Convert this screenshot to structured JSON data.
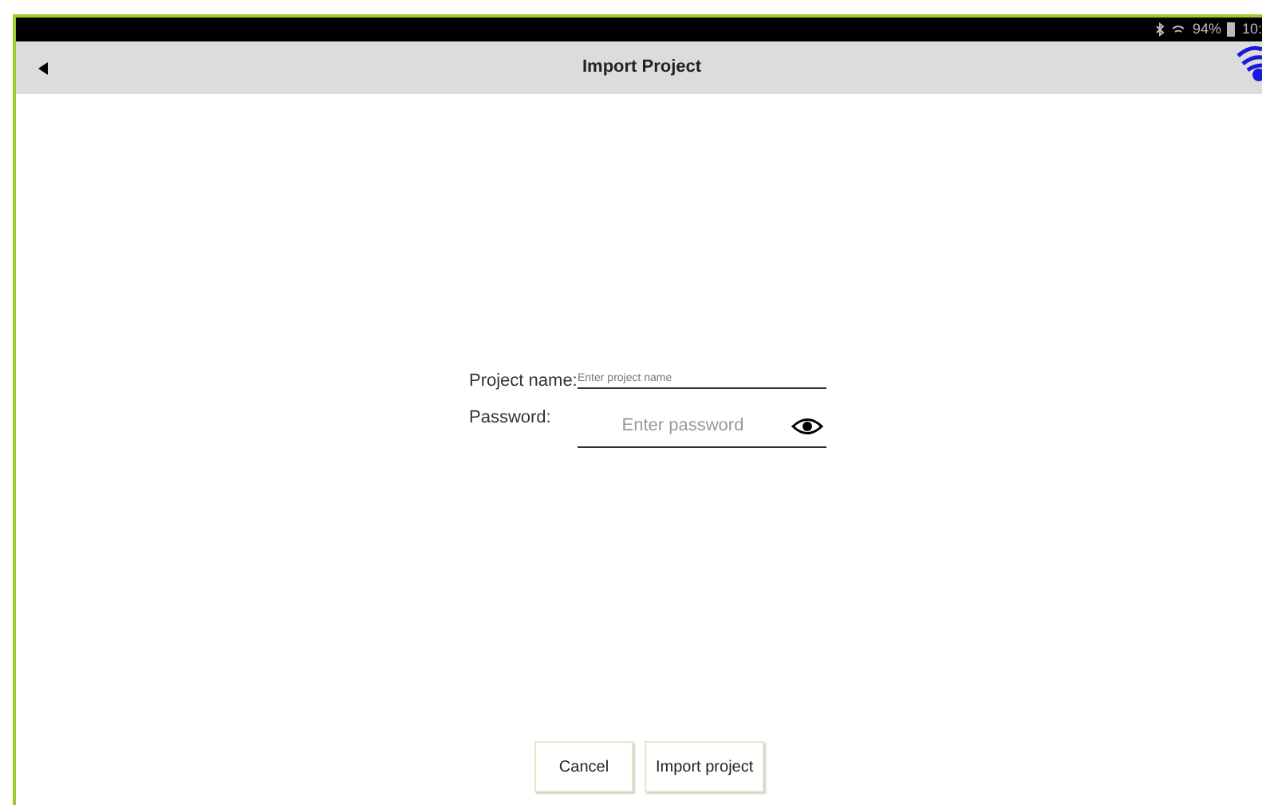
{
  "status_bar": {
    "battery": "94%",
    "time": "10:"
  },
  "header": {
    "title": "Import Project"
  },
  "form": {
    "fields": [
      {
        "label": "Project name:",
        "placeholder": "Enter project name",
        "kind": "text"
      },
      {
        "label": "Password:",
        "placeholder": "Enter password",
        "kind": "password"
      }
    ]
  },
  "buttons": [
    "Cancel",
    "Import project"
  ]
}
